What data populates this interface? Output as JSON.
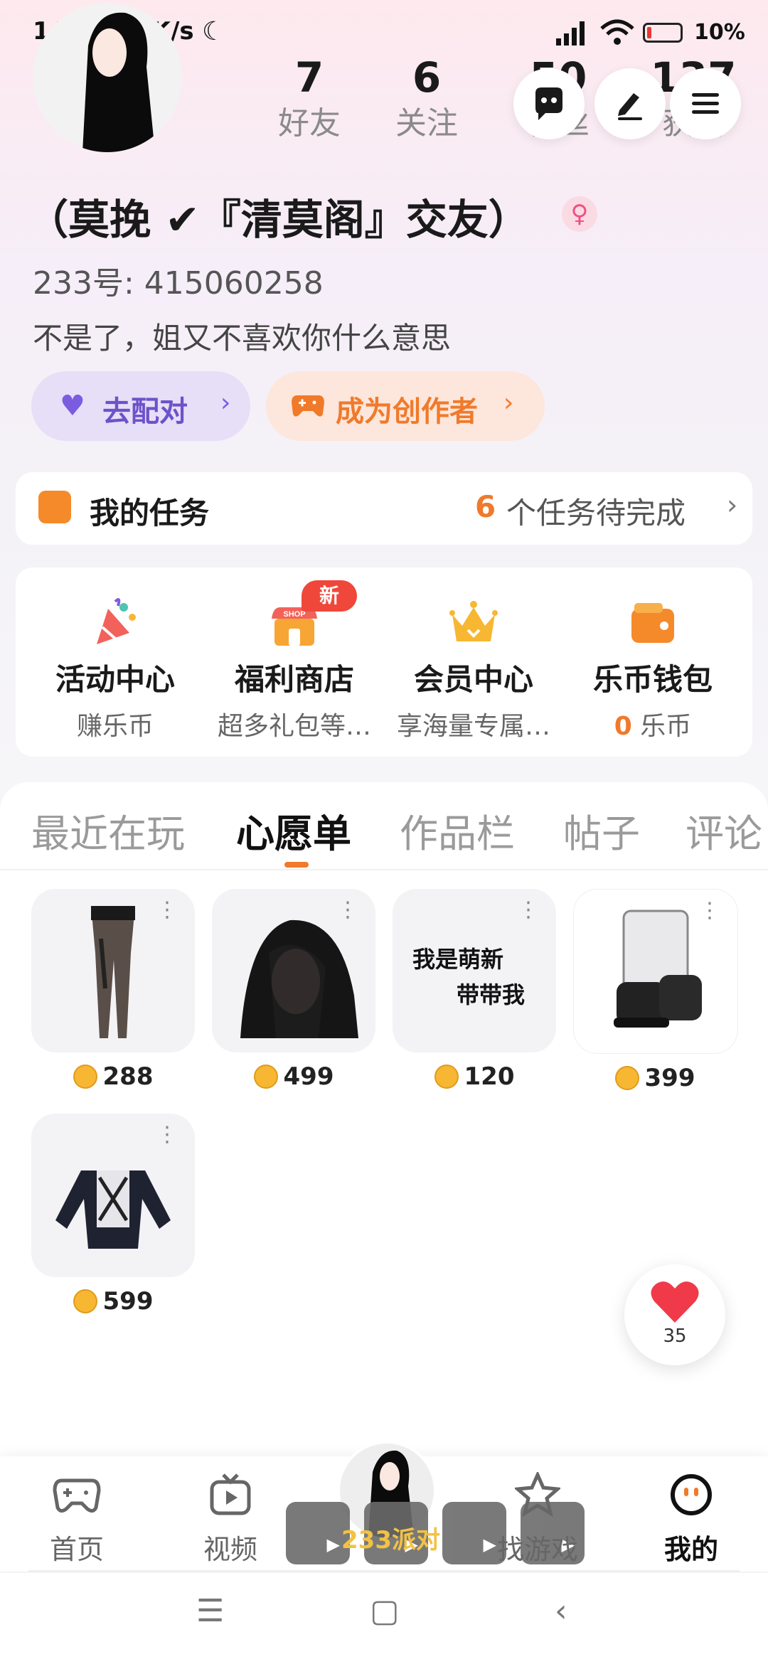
{
  "status_bar": {
    "time": "14:12",
    "speed": "3K/s",
    "battery": "10%"
  },
  "profile": {
    "name": "（莫挽 ✔『清莫阁』交友）",
    "gender_symbol": "♀",
    "uid": "233号: 415060258",
    "bio": "不是了，姐又不喜欢你什么意思",
    "stats": [
      {
        "value": "7",
        "label": "好友"
      },
      {
        "value": "6",
        "label": "关注"
      },
      {
        "value": "50",
        "label": "粉丝"
      },
      {
        "value": "137",
        "label": "获赞"
      }
    ],
    "match_label": "去配对",
    "creator_label": "成为创作者"
  },
  "tasks": {
    "title": "我的任务",
    "count": "6",
    "remaining": " 个任务待完成"
  },
  "quick": [
    {
      "title": "活动中心",
      "sub": "赚乐币",
      "icon": "party-popper-icon"
    },
    {
      "title": "福利商店",
      "sub": "超多礼包等…",
      "icon": "shop-icon",
      "badge": "新"
    },
    {
      "title": "会员中心",
      "sub": "享海量专属…",
      "icon": "crown-icon"
    },
    {
      "title": "乐币钱包",
      "sub_value": "0",
      "sub": " 乐币",
      "icon": "wallet-icon"
    }
  ],
  "tabs": [
    "最近在玩",
    "心愿单",
    "作品栏",
    "帖子",
    "评论"
  ],
  "active_tab": "心愿单",
  "wishlist": [
    {
      "price": "288",
      "kind": "leggings"
    },
    {
      "price": "499",
      "kind": "hair"
    },
    {
      "price": "120",
      "kind": "text-sticker",
      "text_line1": "我是萌新",
      "text_line2": "带带我"
    },
    {
      "price": "399",
      "kind": "boots"
    },
    {
      "price": "599",
      "kind": "jacket"
    }
  ],
  "like_count": "35",
  "nav": [
    {
      "label": "首页",
      "icon": "gamepad-icon"
    },
    {
      "label": "视频",
      "icon": "tv-icon"
    },
    {
      "label": "233派对",
      "icon": "avatar"
    },
    {
      "label": "找游戏",
      "icon": "star-icon"
    },
    {
      "label": "我的",
      "icon": "smile-icon"
    }
  ],
  "colors": {
    "accent": "#f07a2a",
    "purple": "#6d52c9",
    "like": "#f03a4a"
  }
}
